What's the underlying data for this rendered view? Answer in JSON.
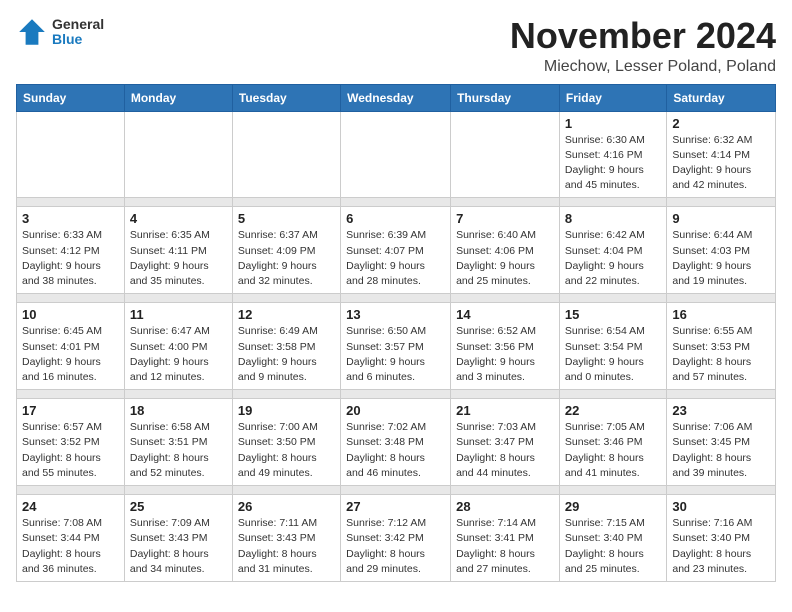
{
  "logo": {
    "general": "General",
    "blue": "Blue"
  },
  "title": "November 2024",
  "subtitle": "Miechow, Lesser Poland, Poland",
  "headers": [
    "Sunday",
    "Monday",
    "Tuesday",
    "Wednesday",
    "Thursday",
    "Friday",
    "Saturday"
  ],
  "weeks": [
    [
      {
        "day": "",
        "info": ""
      },
      {
        "day": "",
        "info": ""
      },
      {
        "day": "",
        "info": ""
      },
      {
        "day": "",
        "info": ""
      },
      {
        "day": "",
        "info": ""
      },
      {
        "day": "1",
        "info": "Sunrise: 6:30 AM\nSunset: 4:16 PM\nDaylight: 9 hours\nand 45 minutes."
      },
      {
        "day": "2",
        "info": "Sunrise: 6:32 AM\nSunset: 4:14 PM\nDaylight: 9 hours\nand 42 minutes."
      }
    ],
    [
      {
        "day": "3",
        "info": "Sunrise: 6:33 AM\nSunset: 4:12 PM\nDaylight: 9 hours\nand 38 minutes."
      },
      {
        "day": "4",
        "info": "Sunrise: 6:35 AM\nSunset: 4:11 PM\nDaylight: 9 hours\nand 35 minutes."
      },
      {
        "day": "5",
        "info": "Sunrise: 6:37 AM\nSunset: 4:09 PM\nDaylight: 9 hours\nand 32 minutes."
      },
      {
        "day": "6",
        "info": "Sunrise: 6:39 AM\nSunset: 4:07 PM\nDaylight: 9 hours\nand 28 minutes."
      },
      {
        "day": "7",
        "info": "Sunrise: 6:40 AM\nSunset: 4:06 PM\nDaylight: 9 hours\nand 25 minutes."
      },
      {
        "day": "8",
        "info": "Sunrise: 6:42 AM\nSunset: 4:04 PM\nDaylight: 9 hours\nand 22 minutes."
      },
      {
        "day": "9",
        "info": "Sunrise: 6:44 AM\nSunset: 4:03 PM\nDaylight: 9 hours\nand 19 minutes."
      }
    ],
    [
      {
        "day": "10",
        "info": "Sunrise: 6:45 AM\nSunset: 4:01 PM\nDaylight: 9 hours\nand 16 minutes."
      },
      {
        "day": "11",
        "info": "Sunrise: 6:47 AM\nSunset: 4:00 PM\nDaylight: 9 hours\nand 12 minutes."
      },
      {
        "day": "12",
        "info": "Sunrise: 6:49 AM\nSunset: 3:58 PM\nDaylight: 9 hours\nand 9 minutes."
      },
      {
        "day": "13",
        "info": "Sunrise: 6:50 AM\nSunset: 3:57 PM\nDaylight: 9 hours\nand 6 minutes."
      },
      {
        "day": "14",
        "info": "Sunrise: 6:52 AM\nSunset: 3:56 PM\nDaylight: 9 hours\nand 3 minutes."
      },
      {
        "day": "15",
        "info": "Sunrise: 6:54 AM\nSunset: 3:54 PM\nDaylight: 9 hours\nand 0 minutes."
      },
      {
        "day": "16",
        "info": "Sunrise: 6:55 AM\nSunset: 3:53 PM\nDaylight: 8 hours\nand 57 minutes."
      }
    ],
    [
      {
        "day": "17",
        "info": "Sunrise: 6:57 AM\nSunset: 3:52 PM\nDaylight: 8 hours\nand 55 minutes."
      },
      {
        "day": "18",
        "info": "Sunrise: 6:58 AM\nSunset: 3:51 PM\nDaylight: 8 hours\nand 52 minutes."
      },
      {
        "day": "19",
        "info": "Sunrise: 7:00 AM\nSunset: 3:50 PM\nDaylight: 8 hours\nand 49 minutes."
      },
      {
        "day": "20",
        "info": "Sunrise: 7:02 AM\nSunset: 3:48 PM\nDaylight: 8 hours\nand 46 minutes."
      },
      {
        "day": "21",
        "info": "Sunrise: 7:03 AM\nSunset: 3:47 PM\nDaylight: 8 hours\nand 44 minutes."
      },
      {
        "day": "22",
        "info": "Sunrise: 7:05 AM\nSunset: 3:46 PM\nDaylight: 8 hours\nand 41 minutes."
      },
      {
        "day": "23",
        "info": "Sunrise: 7:06 AM\nSunset: 3:45 PM\nDaylight: 8 hours\nand 39 minutes."
      }
    ],
    [
      {
        "day": "24",
        "info": "Sunrise: 7:08 AM\nSunset: 3:44 PM\nDaylight: 8 hours\nand 36 minutes."
      },
      {
        "day": "25",
        "info": "Sunrise: 7:09 AM\nSunset: 3:43 PM\nDaylight: 8 hours\nand 34 minutes."
      },
      {
        "day": "26",
        "info": "Sunrise: 7:11 AM\nSunset: 3:43 PM\nDaylight: 8 hours\nand 31 minutes."
      },
      {
        "day": "27",
        "info": "Sunrise: 7:12 AM\nSunset: 3:42 PM\nDaylight: 8 hours\nand 29 minutes."
      },
      {
        "day": "28",
        "info": "Sunrise: 7:14 AM\nSunset: 3:41 PM\nDaylight: 8 hours\nand 27 minutes."
      },
      {
        "day": "29",
        "info": "Sunrise: 7:15 AM\nSunset: 3:40 PM\nDaylight: 8 hours\nand 25 minutes."
      },
      {
        "day": "30",
        "info": "Sunrise: 7:16 AM\nSunset: 3:40 PM\nDaylight: 8 hours\nand 23 minutes."
      }
    ]
  ]
}
